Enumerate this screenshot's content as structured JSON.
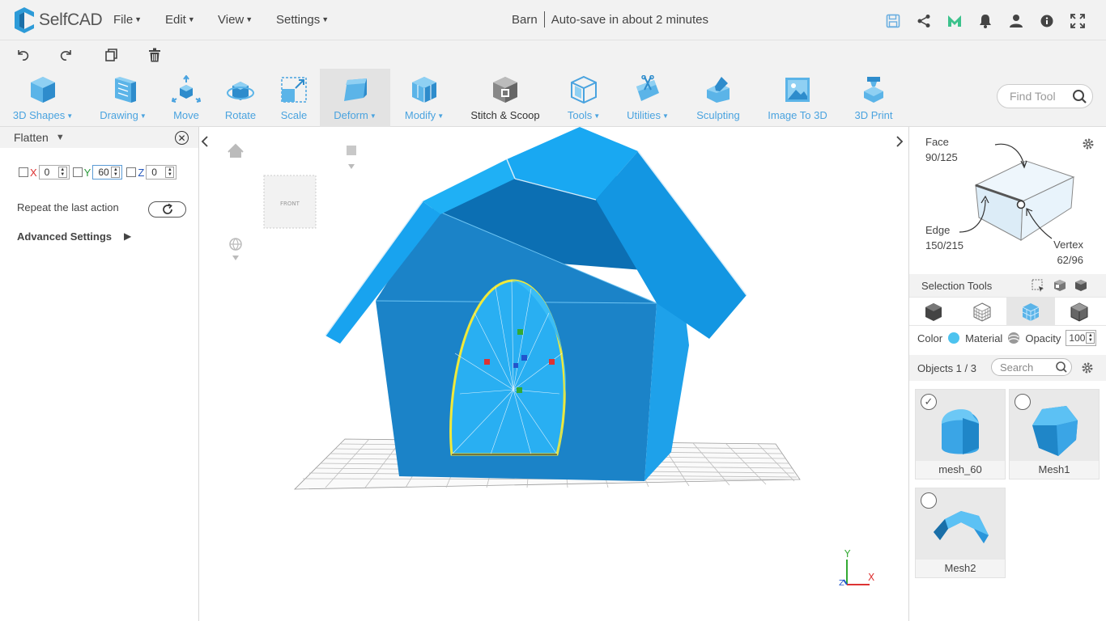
{
  "app": {
    "name": "SelfCAD",
    "project": "Barn",
    "autosave": "Auto-save in about 2 minutes"
  },
  "menus": [
    {
      "label": "File"
    },
    {
      "label": "Edit"
    },
    {
      "label": "View"
    },
    {
      "label": "Settings"
    }
  ],
  "top_icons": [
    "save-icon",
    "share-icon",
    "m-logo-icon",
    "bell-icon",
    "user-icon",
    "info-icon",
    "fullscreen-icon"
  ],
  "actions": [
    "undo-icon",
    "redo-icon",
    "copy-icon",
    "trash-icon"
  ],
  "tools": [
    {
      "label": "3D Shapes",
      "dropdown": true
    },
    {
      "label": "Drawing",
      "dropdown": true
    },
    {
      "label": "Move",
      "dropdown": false
    },
    {
      "label": "Rotate",
      "dropdown": false
    },
    {
      "label": "Scale",
      "dropdown": false
    },
    {
      "label": "Deform",
      "dropdown": true,
      "active": true
    },
    {
      "label": "Modify",
      "dropdown": true
    },
    {
      "label": "Stitch & Scoop",
      "dropdown": false
    },
    {
      "label": "Tools",
      "dropdown": true
    },
    {
      "label": "Utilities",
      "dropdown": true
    },
    {
      "label": "Sculpting",
      "dropdown": false
    },
    {
      "label": "Image To 3D",
      "dropdown": false
    },
    {
      "label": "3D Print",
      "dropdown": false
    }
  ],
  "find_tool": {
    "placeholder": "Find Tool"
  },
  "left_panel": {
    "title": "Flatten",
    "axes": [
      {
        "label": "X",
        "value": "0",
        "checked": false
      },
      {
        "label": "Y",
        "value": "60",
        "checked": false
      },
      {
        "label": "Z",
        "value": "0",
        "checked": false
      }
    ],
    "repeat_label": "Repeat the last action",
    "advanced_label": "Advanced Settings"
  },
  "viewport": {
    "view_cube_label": "FRONT",
    "axis_labels": {
      "x": "X",
      "y": "Y",
      "z": "Z"
    }
  },
  "right_panel": {
    "face_label": "Face",
    "face_count": "90/125",
    "edge_label": "Edge",
    "edge_count": "150/215",
    "vertex_label": "Vertex",
    "vertex_count": "62/96",
    "selection_tools_label": "Selection Tools",
    "color_label": "Color",
    "material_label": "Material",
    "opacity_label": "Opacity",
    "opacity_value": "100",
    "objects_label": "Objects 1 / 3",
    "search_placeholder": "Search",
    "objects": [
      {
        "name": "mesh_60",
        "checked": true
      },
      {
        "name": "Mesh1",
        "checked": false
      },
      {
        "name": "Mesh2",
        "checked": false
      }
    ]
  },
  "colors": {
    "accent": "#4aa3df",
    "mesh_blue": "#1b8fd6",
    "mesh_dark": "#0c6fb3",
    "selection": "#f0e93a"
  }
}
